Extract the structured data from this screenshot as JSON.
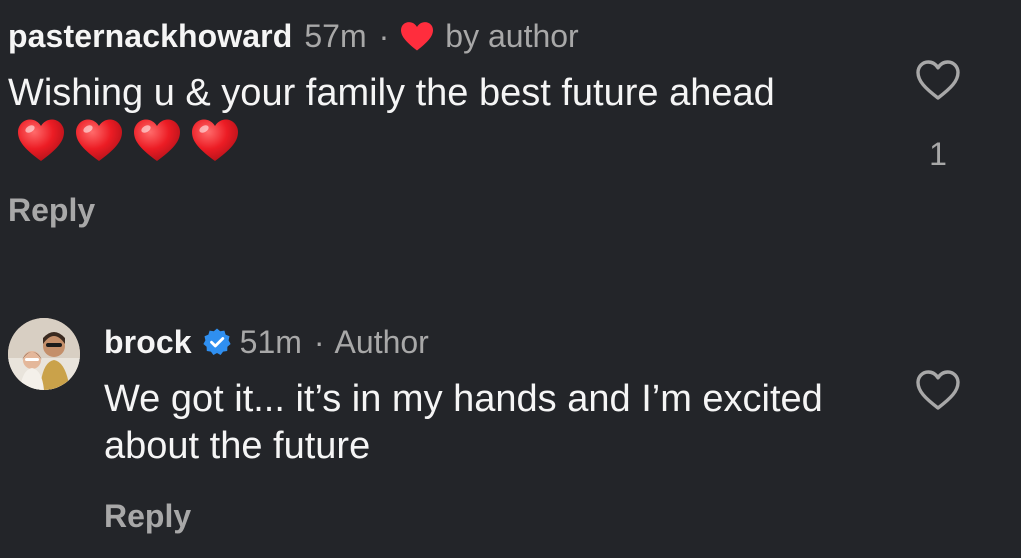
{
  "comments": [
    {
      "username": "pasternackhoward",
      "time": "57m",
      "separator": "·",
      "liked_by_author": "by author",
      "text": "Wishing u & your family the best future ahead",
      "reply_label": "Reply",
      "like_count": "1",
      "emoji_count": 4
    },
    {
      "username": "brock",
      "time": "51m",
      "separator": "·",
      "author_badge": "Author",
      "text": "We got it... it’s in my hands and I’m excited about the future",
      "reply_label": "Reply",
      "verified": true
    }
  ],
  "colors": {
    "background": "#232529",
    "primary_text": "#f5f5f5",
    "secondary_text": "#a8a8a8",
    "heart_red": "#ff2d3d",
    "verified_blue": "#2f8ff0"
  },
  "icons": [
    "heart-filled-icon",
    "heart-outline-icon",
    "verified-badge-icon",
    "red-heart-emoji"
  ]
}
